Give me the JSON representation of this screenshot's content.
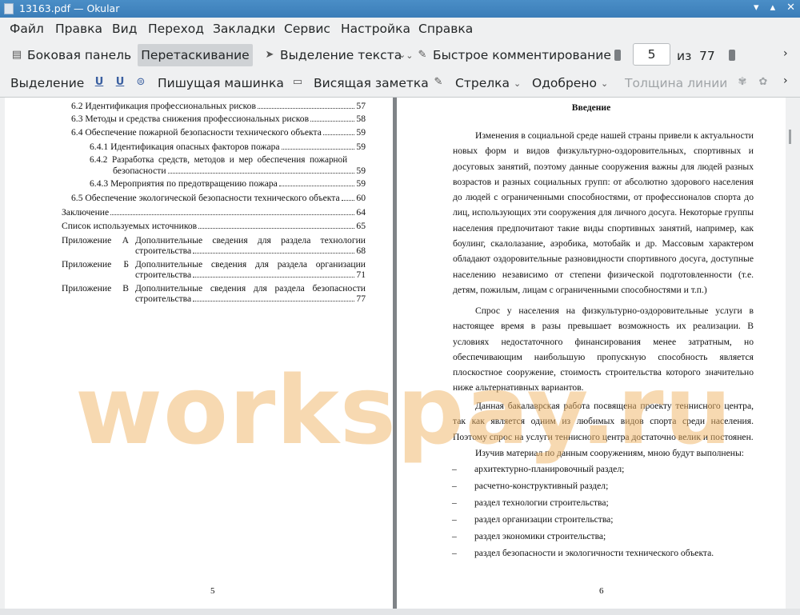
{
  "window": {
    "title": "13163.pdf  — Okular"
  },
  "menu": [
    "Файл",
    "Правка",
    "Вид",
    "Переход",
    "Закладки",
    "Сервис",
    "Настройка",
    "Справка"
  ],
  "toolbar1": {
    "sidebar": "Боковая панель",
    "drag": "Перетаскивание",
    "text_select": "Выделение текста",
    "quick_comment": "Быстрое комментирование",
    "page_current": "5",
    "page_of": "из",
    "page_total": "77"
  },
  "toolbar2": {
    "highlight": "Выделение",
    "typewriter": "Пишущая машинка",
    "sticky_note": "Висящая заметка",
    "arrow": "Стрелка",
    "stamp": "Одобрено",
    "line_width": "Толщина линии"
  },
  "left_page": {
    "toc": [
      {
        "text": "6.2 Идентификация профессиональных рисков",
        "page": "57"
      },
      {
        "text": "6.3 Методы и средства снижения профессиональных рисков",
        "page": "58"
      },
      {
        "text": "6.4 Обеспечение пожарной безопасности технического объекта",
        "page": "59"
      },
      {
        "text": "6.4.1 Идентификация опасных факторов пожара",
        "page": "59"
      },
      {
        "text": "6.4.2  Разработка  средств,  методов  и  мер  обеспечения  пожарной",
        "text2": "безопасности",
        "page": "59"
      },
      {
        "text": "6.4.3 Мероприятия по предотвращению пожара",
        "page": "59"
      },
      {
        "text": "6.5 Обеспечение экологической безопасности технического объекта",
        "page": "60"
      },
      {
        "text": "Заключение",
        "page": "64"
      },
      {
        "text": "Список используемых источников",
        "page": "65"
      }
    ],
    "appendices": [
      {
        "label": "Приложение",
        "letter": "А",
        "line1": "Дополнительные  сведения  для  раздела  технологии",
        "line2": "строительства",
        "page": "68"
      },
      {
        "label": "Приложение",
        "letter": "Б",
        "line1": "Дополнительные  сведения  для  раздела  организации",
        "line2": "строительства",
        "page": "71"
      },
      {
        "label": "Приложение",
        "letter": "В",
        "line1": "Дополнительные  сведения  для  раздела  безопасности",
        "line2": "строительства",
        "page": "77"
      }
    ],
    "page_number": "5"
  },
  "right_page": {
    "heading": "Введение",
    "paragraphs": [
      "Изменения в социальной среде нашей страны привели к актуальности новых форм и видов физкультурно-оздоровительных, спортивных и досуговых занятий, поэтому данные сооружения важны для людей разных возрастов и разных социальных групп: от абсолютно здорового населения до людей с ограниченными способностями, от профессионалов спорта до лиц, использующих эти сооружения для личного досуга. Некоторые группы населения предпочитают такие виды спортивных занятий, например, как боулинг, скалолазание, аэробика, мотобайк и др. Массовым характером обладают оздоровительные разновидности спортивного досуга, доступные населению независимо от степени физической подготовленности (т.е. детям, пожилым, лицам с ограниченными способностями и т.п.)",
      "Спрос у населения на физкультурно-оздоровительные услуги в настоящее время в разы превышает возможность их реализации. В условиях недостаточного финансирования менее затратным, но обеспечивающим наибольшую пропускную способность является плоскостное сооружение, стоимость строительства которого значительно ниже альтернативных вариантов.",
      "Данная бакалаврская работа посвящена проекту теннисного центра, так как является одним из любимых видов спорта среди населения. Поэтому спрос на услуги теннисного центра достаточно велик и постоянен.",
      "Изучив материал по данным сооружениям, мною будут выполнены:"
    ],
    "list_dash": "–",
    "list": [
      "архитектурно-планировочный раздел;",
      "расчетно-конструктивный раздел;",
      "раздел технологии строительства;",
      "раздел организации строительства;",
      "раздел экономики строительства;",
      "раздел безопасности и экологичности технического объекта."
    ],
    "page_number": "6"
  },
  "watermark": "workspay.ru"
}
